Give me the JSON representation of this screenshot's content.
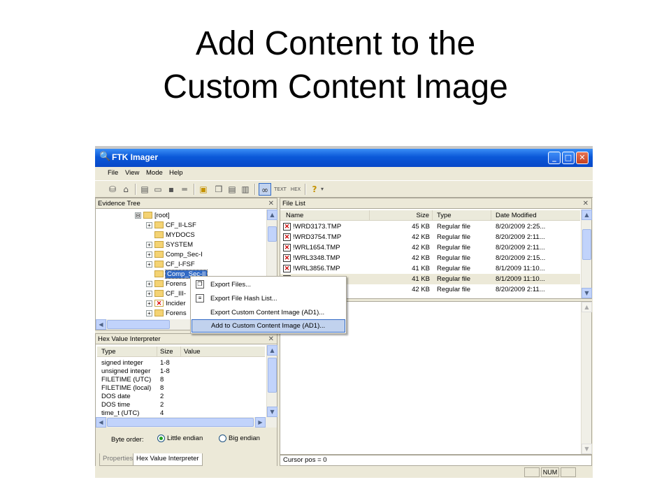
{
  "slide": {
    "title_line1": "Add Content to the",
    "title_line2": "Custom Content Image"
  },
  "window": {
    "title": "FTK Imager",
    "minimize": "_",
    "maximize": "□",
    "close": "✕"
  },
  "menu": [
    "File",
    "View",
    "Mode",
    "Help"
  ],
  "evidence_tree": {
    "title": "Evidence Tree",
    "items": [
      {
        "label": "[root]",
        "expander": "⊟",
        "icon": "folder-open"
      },
      {
        "label": "CF_II-LSF",
        "expander": "+",
        "icon": "folder"
      },
      {
        "label": "MYDOCS",
        "expander": "",
        "icon": "folder"
      },
      {
        "label": "SYSTEM",
        "expander": "+",
        "icon": "folder"
      },
      {
        "label": "Comp_Sec-I",
        "expander": "+",
        "icon": "folder"
      },
      {
        "label": "CF_I-FSF",
        "expander": "+",
        "icon": "folder"
      },
      {
        "label": "Comp_Sec-II",
        "expander": "",
        "icon": "folder",
        "selected": true
      },
      {
        "label": "Forens",
        "expander": "+",
        "icon": "folder"
      },
      {
        "label": "CF_III-",
        "expander": "+",
        "icon": "folder"
      },
      {
        "label": "Incider",
        "expander": "+",
        "icon": "folder-deleted"
      },
      {
        "label": "Forens",
        "expander": "+",
        "icon": "folder"
      }
    ]
  },
  "context_menu": {
    "items": [
      {
        "label": "Export Files...",
        "icon": "export-icon"
      },
      {
        "label": "Export File Hash List...",
        "icon": "hash-list-icon"
      },
      {
        "label": "Export Custom Content Image (AD1)...",
        "icon": ""
      },
      {
        "label": "Add to Custom Content Image (AD1)...",
        "icon": "",
        "highlighted": true
      }
    ]
  },
  "file_list": {
    "title": "File List",
    "columns": [
      "Name",
      "Size",
      "Type",
      "Date Modified"
    ],
    "rows": [
      {
        "name": "!WRD3173.TMP",
        "size": "45 KB",
        "type": "Regular file",
        "date": "8/20/2009 2:25..."
      },
      {
        "name": "!WRD3754.TMP",
        "size": "42 KB",
        "type": "Regular file",
        "date": "8/20/2009 2:11..."
      },
      {
        "name": "!WRL1654.TMP",
        "size": "42 KB",
        "type": "Regular file",
        "date": "8/20/2009 2:11..."
      },
      {
        "name": "!WRL3348.TMP",
        "size": "42 KB",
        "type": "Regular file",
        "date": "8/20/2009 2:15..."
      },
      {
        "name": "!WRL3856.TMP",
        "size": "41 KB",
        "type": "Regular file",
        "date": "8/1/2009 11:10..."
      },
      {
        "name": "",
        "size": "41 KB",
        "type": "Regular file",
        "date": "8/1/2009 11:10...",
        "highlighted": true
      },
      {
        "name": "",
        "size": "42 KB",
        "type": "Regular file",
        "date": "8/20/2009 2:11..."
      }
    ]
  },
  "hex_interpreter": {
    "title": "Hex Value Interpreter",
    "columns": [
      "Type",
      "Size",
      "Value"
    ],
    "rows": [
      {
        "type": "signed integer",
        "size": "1-8"
      },
      {
        "type": "unsigned integer",
        "size": "1-8"
      },
      {
        "type": "FILETIME (UTC)",
        "size": "8"
      },
      {
        "type": "FILETIME (local)",
        "size": "8"
      },
      {
        "type": "DOS date",
        "size": "2"
      },
      {
        "type": "DOS time",
        "size": "2"
      },
      {
        "type": "time_t (UTC)",
        "size": "4"
      }
    ],
    "byte_order_label": "Byte order:",
    "little_endian": "Little endian",
    "big_endian": "Big endian"
  },
  "bottom_tabs": [
    "Properties",
    "Hex Value Interpreter"
  ],
  "cursor_pos": "Cursor pos = 0",
  "status": {
    "num": "NUM"
  }
}
